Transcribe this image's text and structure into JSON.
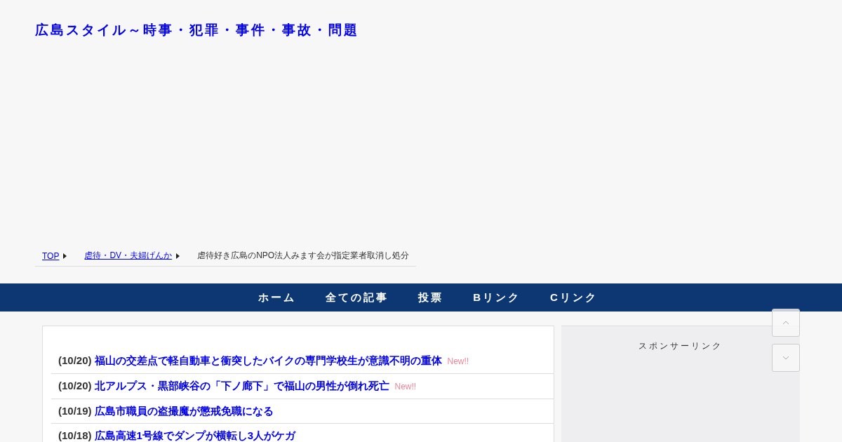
{
  "site_title": "広島スタイル～時事・犯罪・事件・事故・問題",
  "breadcrumb": {
    "links": [
      "TOP",
      "虐待・DV・夫婦げんか"
    ],
    "current": "虐待好き広島のNPO法人みます会が指定業者取消し処分"
  },
  "nav": [
    "ホーム",
    "全ての記事",
    "投票",
    "Bリンク",
    "Cリンク"
  ],
  "articles": [
    {
      "date": "(10/20)",
      "title": "福山の交差点で軽自動車と衝突したバイクの専門学校生が意識不明の重体",
      "new": true,
      "badge": "New!!"
    },
    {
      "date": "(10/20)",
      "title": "北アルプス・黒部峡谷の「下ノ廊下」で福山の男性が倒れ死亡",
      "new": true,
      "badge": "New!!"
    },
    {
      "date": "(10/19)",
      "title": "広島市職員の盗撮魔が懲戒免職になる",
      "new": false
    },
    {
      "date": "(10/18)",
      "title": "広島高速1号線でダンプが横転し3人がケガ",
      "new": false
    }
  ],
  "sidebar": {
    "heading": "スポンサーリンク"
  }
}
